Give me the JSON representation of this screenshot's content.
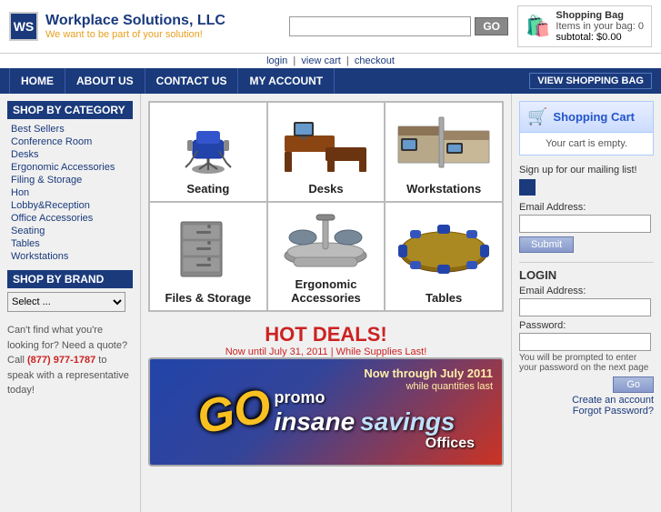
{
  "header": {
    "logo_letters": "WS",
    "logo_title": "Workplace Solutions, LLC",
    "logo_subtitle": "We want to be part of your solution!",
    "search_placeholder": "",
    "search_button": "GO",
    "cart_icon": "🛒",
    "cart_title": "Shopping Bag",
    "cart_items": "Items in your bag: 0",
    "cart_subtotal": "subtotal: $0.00",
    "auth_login": "login",
    "auth_view_cart": "view cart",
    "auth_checkout": "checkout"
  },
  "navbar": {
    "items": [
      "HOME",
      "ABOUT US",
      "CONTACT US",
      "MY ACCOUNT"
    ],
    "view_bag": "VIEW SHOPPING BAG"
  },
  "sidebar": {
    "category_title": "SHOP BY CATEGORY",
    "links": [
      "Best Sellers",
      "Conference Room",
      "Desks",
      "Ergonomic Accessories",
      "Filing & Storage",
      "Hon",
      "Lobby&Reception",
      "Office Accessories",
      "Seating",
      "Tables",
      "Workstations"
    ],
    "brand_title": "SHOP BY BRAND",
    "brand_select_default": "Select ...",
    "contact_text": "Can't find what you're looking for? Need a quote? Call ",
    "phone": "(877) 977-1787",
    "contact_suffix": " to speak with a representative today!"
  },
  "categories": [
    {
      "label": "Seating",
      "id": "seating"
    },
    {
      "label": "Desks",
      "id": "desks"
    },
    {
      "label": "Workstations",
      "id": "workstations"
    },
    {
      "label": "Files & Storage",
      "id": "files-storage"
    },
    {
      "label": "Ergonomic Accessories",
      "id": "ergonomic"
    },
    {
      "label": "Tables",
      "id": "tables"
    }
  ],
  "hot_deals": {
    "title": "HOT DEALS!",
    "subtitle": "Now until July 31, 2011 | While Supplies Last!",
    "banner_now": "Now through July 2011",
    "banner_while": "while quantities last",
    "banner_go": "GO",
    "banner_promo": "promo",
    "banner_offices": "Offices",
    "banner_insane": "insane",
    "banner_savings": "savings"
  },
  "right_panel": {
    "cart_title": "Shopping Cart",
    "cart_empty": "Your cart is empty.",
    "mailing_label": "Sign up for our mailing list!",
    "email_address_label": "Email Address:",
    "submit_button": "Submit",
    "login_title": "LOGIN",
    "login_email_label": "Email Address:",
    "login_pass_label": "Password:",
    "login_pass_note": "You will be prompted to enter your password on the next page",
    "login_go": "Go",
    "create_account": "Create an account",
    "forgot_password": "Forgot Password?"
  }
}
